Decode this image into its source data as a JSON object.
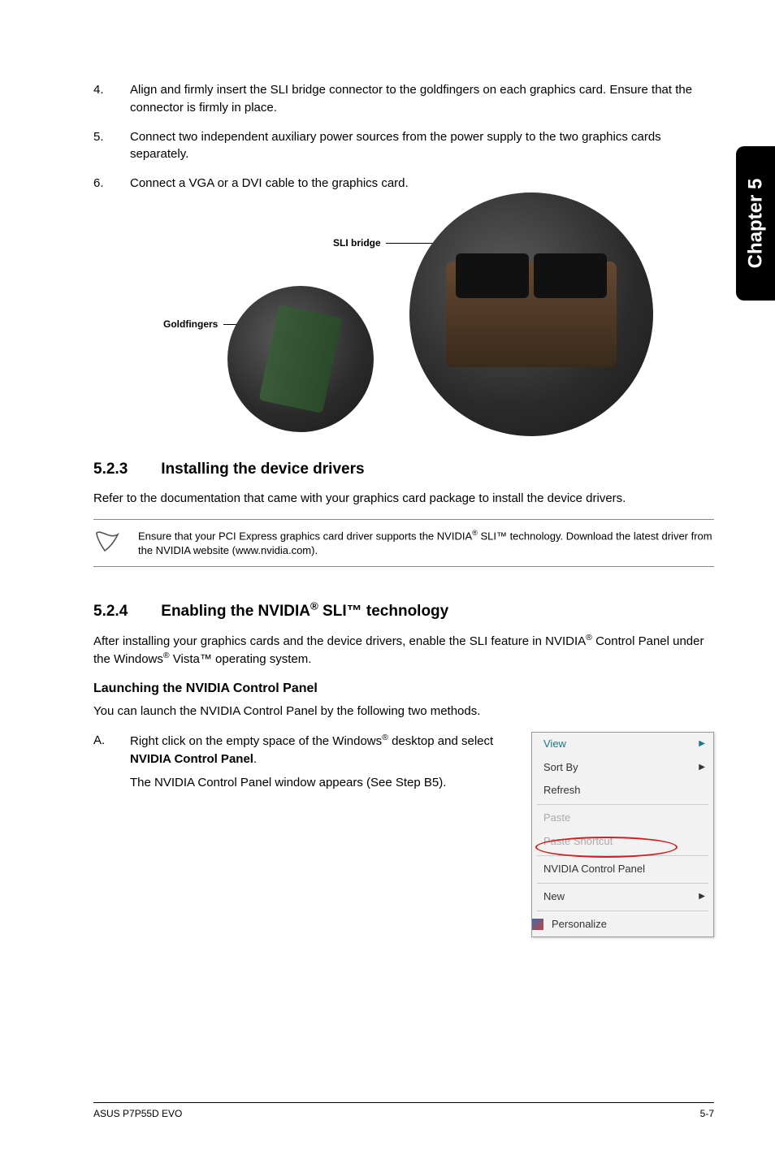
{
  "steps": [
    {
      "num": "4.",
      "text": "Align and firmly insert the SLI bridge connector to the goldfingers on each graphics card. Ensure that the connector is firmly in place."
    },
    {
      "num": "5.",
      "text": "Connect two independent auxiliary power sources from the power supply to the two graphics cards separately."
    },
    {
      "num": "6.",
      "text": "Connect a VGA or a DVI cable to the graphics card."
    }
  ],
  "figure": {
    "sli_label": "SLI bridge",
    "gold_label": "Goldfingers"
  },
  "chapter_tab": "Chapter 5",
  "section523": {
    "num": "5.2.3",
    "title": "Installing the device drivers",
    "para": "Refer to the documentation that came with your graphics card package to install the device drivers.",
    "note_prefix": "Ensure that your PCI Express graphics card driver supports the NVIDIA",
    "note_suffix": " SLI™ technology. Download the latest driver from the NVIDIA website (www.nvidia.com)."
  },
  "section524": {
    "num": "5.2.4",
    "title_prefix": "Enabling the NVIDIA",
    "title_suffix": " SLI™ technology",
    "para_prefix": "After installing your graphics cards and the device drivers, enable the SLI feature in NVIDIA",
    "para_mid": " Control Panel under the Windows",
    "para_suffix": " Vista™ operating system.",
    "sub_heading": "Launching the NVIDIA Control Panel",
    "sub_para": "You can launch the NVIDIA Control Panel by the following two methods.",
    "item_a_num": "A.",
    "item_a_line1_prefix": "Right click on the empty space of the Windows",
    "item_a_line1_suffix": " desktop and select ",
    "item_a_line1_bold": "NVIDIA Control Panel",
    "item_a_line1_end": ".",
    "item_a_line2": "The NVIDIA Control Panel window appears (See Step B5)."
  },
  "context_menu": {
    "view": "View",
    "sort_by": "Sort By",
    "refresh": "Refresh",
    "paste": "Paste",
    "paste_shortcut": "Paste Shortcut",
    "nvidia": "NVIDIA Control Panel",
    "new": "New",
    "personalize": "Personalize"
  },
  "footer": {
    "left": "ASUS P7P55D EVO",
    "right": "5-7"
  }
}
